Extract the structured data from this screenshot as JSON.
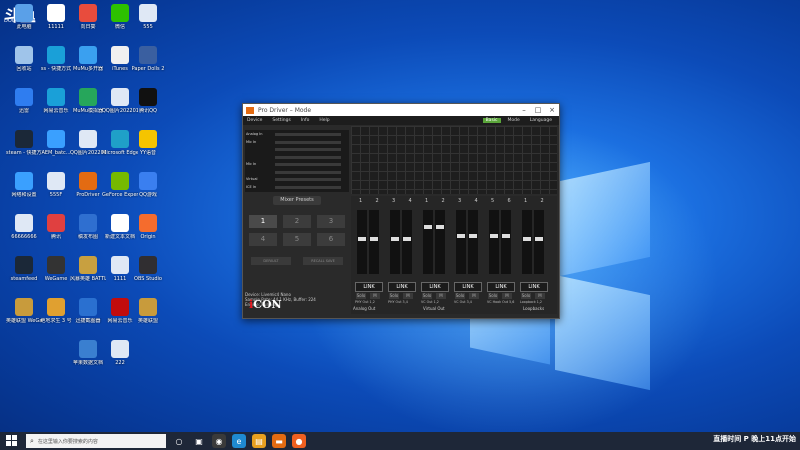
{
  "watermark": {
    "logo": "斗鱼",
    "sub": "DOUYU.COM"
  },
  "desktop_icons": [
    {
      "label": "此电脑",
      "icon": "computer-icon",
      "color": "#5aa0e8"
    },
    {
      "label": "11111",
      "icon": "file-icon",
      "color": "#ffffff"
    },
    {
      "label": "向日葵",
      "icon": "sunflower-icon",
      "color": "#e84c3d"
    },
    {
      "label": "微信",
      "icon": "wechat-icon",
      "color": "#2dc100"
    },
    {
      "label": "555",
      "icon": "image-file-icon",
      "color": "#dfe8f5"
    },
    {
      "label": "回收站",
      "icon": "recycle-bin-icon",
      "color": "#9fc4ea"
    },
    {
      "label": "ss - 快捷方式",
      "icon": "app-icon",
      "color": "#1aa0d8"
    },
    {
      "label": "MuMu多开器",
      "icon": "mumu-icon",
      "color": "#3aa0f0"
    },
    {
      "label": "iTunes",
      "icon": "music-icon",
      "color": "#f0f0f0"
    },
    {
      "label": "Paper Dolls 2",
      "icon": "game-icon",
      "color": "#3a5fa0"
    },
    {
      "label": "迅雷",
      "icon": "thunder-icon",
      "color": "#2f7df0"
    },
    {
      "label": "网易云音乐",
      "icon": "music-app-icon",
      "color": "#1aa0d8"
    },
    {
      "label": "MuMu模拟器",
      "icon": "mumu-emulator-icon",
      "color": "#26a65b"
    },
    {
      "label": "QQ图片20220129...",
      "icon": "image-file-icon",
      "color": "#dfe8f5"
    },
    {
      "label": "腾讯QQ",
      "icon": "qq-icon",
      "color": "#111111"
    },
    {
      "label": "steam - 快捷方式",
      "icon": "steam-icon",
      "color": "#1b2838"
    },
    {
      "label": "AEM_batc...",
      "icon": "app-icon",
      "color": "#3aa0ff"
    },
    {
      "label": "QQ图片20220129...",
      "icon": "image-file-icon",
      "color": "#dfe8f5"
    },
    {
      "label": "Microsoft Edge",
      "icon": "edge-icon",
      "color": "#1fa0c8"
    },
    {
      "label": "YY语音",
      "icon": "yy-icon",
      "color": "#f5c400"
    },
    {
      "label": "网络和设置",
      "icon": "network-icon",
      "color": "#3aa0ff"
    },
    {
      "label": "555F",
      "icon": "image-file-icon",
      "color": "#dfe8f5"
    },
    {
      "label": "ProDriver",
      "icon": "prodriver-icon",
      "color": "#e36b12"
    },
    {
      "label": "GeForce Experience",
      "icon": "geforce-icon",
      "color": "#76b900"
    },
    {
      "label": "QQ游戏",
      "icon": "qq-game-icon",
      "color": "#3a7ff0"
    },
    {
      "label": "66666666",
      "icon": "image-file-icon",
      "color": "#dfe8f5"
    },
    {
      "label": "腾讯",
      "icon": "tencent-icon",
      "color": "#e04040"
    },
    {
      "label": "稿发布图",
      "icon": "app-icon",
      "color": "#2f6fd0"
    },
    {
      "label": "新建文本文档",
      "icon": "text-file-icon",
      "color": "#ffffff"
    },
    {
      "label": "Origin",
      "icon": "origin-icon",
      "color": "#f56c2d"
    },
    {
      "label": "steamfeed",
      "icon": "steam-icon",
      "color": "#1b2838"
    },
    {
      "label": "WeGame",
      "icon": "wegame-icon",
      "color": "#333333"
    },
    {
      "label": "风暴英雄 BATTLEGR...",
      "icon": "game-icon",
      "color": "#c8a040"
    },
    {
      "label": "1111",
      "icon": "image-file-icon",
      "color": "#dfe8f5"
    },
    {
      "label": "OBS Studio",
      "icon": "obs-icon",
      "color": "#302e31"
    },
    {
      "label": "英雄联盟 WeGame版",
      "icon": "lol-icon",
      "color": "#c89b3c"
    },
    {
      "label": "绝地求生 3 号",
      "icon": "game-icon",
      "color": "#e0a030"
    },
    {
      "label": "迅捷截图器",
      "icon": "screenshot-icon",
      "color": "#2a70d0"
    },
    {
      "label": "网易云音乐",
      "icon": "music-app-icon",
      "color": "#c20c0c"
    },
    {
      "label": "英雄联盟",
      "icon": "lol-icon",
      "color": "#c89b3c"
    },
    {
      "label": "苹果数据文档",
      "icon": "folder-icon",
      "color": "#3a7fd0"
    },
    {
      "label": "222",
      "icon": "image-file-icon",
      "color": "#dfe8f5"
    }
  ],
  "window": {
    "title": "Pro Driver – Mode",
    "menu": [
      "Device",
      "Settings",
      "Info",
      "Help"
    ],
    "right_buttons": [
      "Basic",
      "Mode",
      "Language"
    ],
    "channels": [
      "Analog In",
      "Mic In",
      "",
      "",
      "Mic In",
      "",
      "Virtual",
      "ICE In"
    ],
    "mixer_presets_label": "Mixer Presets",
    "presets": [
      "1",
      "2",
      "3",
      "4",
      "5",
      "6"
    ],
    "default_label": "DEFAULT",
    "recall_label": "RECALL SAVE",
    "info": [
      "Device: Livemic4 Nano",
      "Sample Rate: 44.1 KHz, Buffer: 224",
      "Engine: Running"
    ],
    "brand": {
      "i": "i",
      "rest": "CON"
    },
    "channel_numbers": [
      "1",
      "2",
      "3",
      "4",
      "1",
      "2",
      "3",
      "4",
      "5",
      "6",
      "1",
      "2"
    ],
    "strips": [
      {
        "link": "LINK",
        "solo": "Solo",
        "mute": "M",
        "label": "PHY Out 1,2",
        "level": 0.55
      },
      {
        "link": "LINK",
        "solo": "Solo",
        "mute": "M",
        "label": "PHY Out 3,4",
        "level": 0.55
      },
      {
        "link": "LINK",
        "solo": "Solo",
        "mute": "M",
        "label": "VC Out 1,2",
        "level": 0.75
      },
      {
        "link": "LINK",
        "solo": "Solo",
        "mute": "M",
        "label": "VC Out 3,4",
        "level": 0.6
      },
      {
        "link": "LINK",
        "solo": "Solo",
        "mute": "M",
        "label": "VC Hook Out 5,6",
        "level": 0.6
      },
      {
        "link": "LINK",
        "solo": "Solo",
        "mute": "M",
        "label": "Loopback 1,2",
        "level": 0.55
      }
    ],
    "groups": [
      "Analog Out",
      "Virtual Out",
      "Loopbacks"
    ]
  },
  "taskbar": {
    "search_placeholder": "在这里输入你要搜索的内容",
    "tray_text": "直播时间 P 晚上11点开始"
  }
}
